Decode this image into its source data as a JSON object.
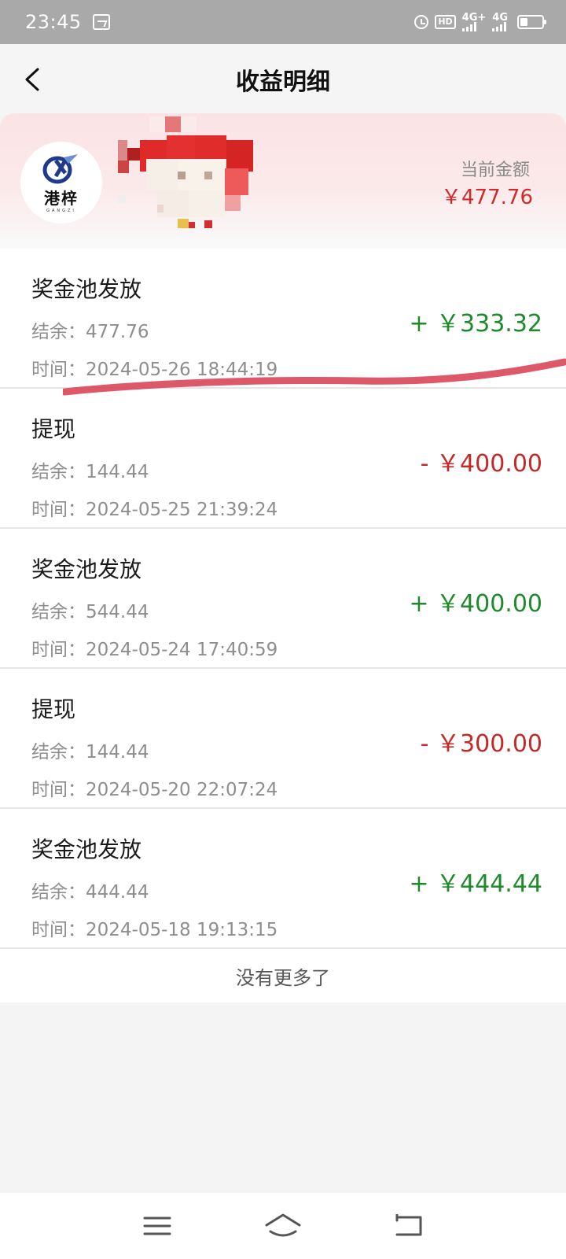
{
  "status_bar": {
    "time": "23:45",
    "hd_label": "HD",
    "network_1": "4G+",
    "network_2": "4G",
    "icons": [
      "image-icon",
      "alarm-icon",
      "hd-icon",
      "signal-icon",
      "signal-icon",
      "battery-icon"
    ]
  },
  "header": {
    "title": "收益明细",
    "back_icon": "chevron-left-icon"
  },
  "user_card": {
    "avatar_text": "港梓",
    "avatar_subtext": "GANGZI",
    "balance_label": "当前金额",
    "balance_value": "￥477.76"
  },
  "records": [
    {
      "title": "奖金池发放",
      "balance_label": "结余：",
      "balance": "477.76",
      "time_label": "时间：",
      "time": "2024-05-26 18:44:19",
      "amount": "+ ￥333.32",
      "type": "positive"
    },
    {
      "title": "提现",
      "balance_label": "结余：",
      "balance": "144.44",
      "time_label": "时间：",
      "time": "2024-05-25 21:39:24",
      "amount": "- ￥400.00",
      "type": "negative"
    },
    {
      "title": "奖金池发放",
      "balance_label": "结余：",
      "balance": "544.44",
      "time_label": "时间：",
      "time": "2024-05-24 17:40:59",
      "amount": "+ ￥400.00",
      "type": "positive"
    },
    {
      "title": "提现",
      "balance_label": "结余：",
      "balance": "144.44",
      "time_label": "时间：",
      "time": "2024-05-20 22:07:24",
      "amount": "- ￥300.00",
      "type": "negative"
    },
    {
      "title": "奖金池发放",
      "balance_label": "结余：",
      "balance": "444.44",
      "time_label": "时间：",
      "time": "2024-05-18 19:13:15",
      "amount": "+ ￥444.44",
      "type": "positive"
    }
  ],
  "footer": {
    "no_more_text": "没有更多了"
  },
  "colors": {
    "positive": "#1e8a2a",
    "negative": "#c62828",
    "accent_red": "#d22a2a"
  },
  "bottom_nav": {
    "icons": [
      "menu-icon",
      "home-icon",
      "back-icon"
    ]
  }
}
